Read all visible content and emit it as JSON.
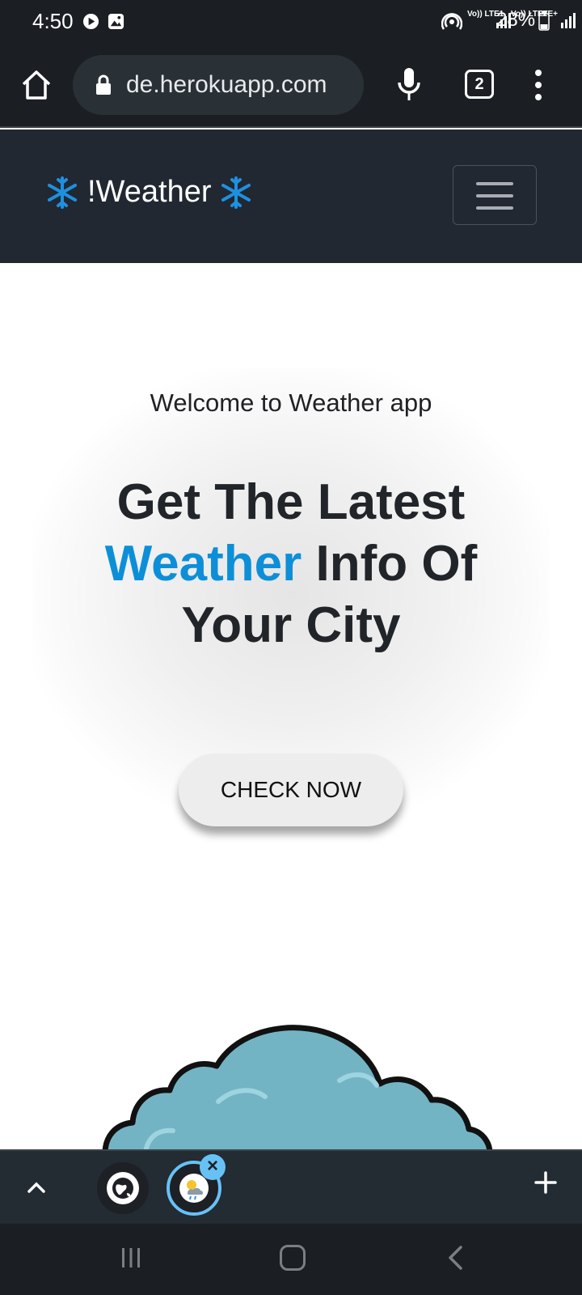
{
  "status_bar": {
    "time": "4:50",
    "battery": "28%",
    "icons": [
      "youtube-music-icon",
      "gallery-icon",
      "hotspot-icon",
      "volte-lte1-icon",
      "signal-icon",
      "volte-lte2-icon",
      "lte-plus-icon",
      "signal-icon",
      "battery-icon"
    ],
    "network_labels": [
      "Vo)) LTE1",
      "Vo)) LTE2",
      "LTE+"
    ]
  },
  "browser": {
    "url": "de.herokuapp.com",
    "tab_count": "2",
    "icons": [
      "home-icon",
      "lock-icon",
      "mic-icon",
      "tabs-icon",
      "more-vert-icon"
    ]
  },
  "navbar": {
    "brand": "!Weather",
    "brand_icon": "snowflake-icon",
    "toggler_icon": "hamburger-icon"
  },
  "hero": {
    "welcome": "Welcome to Weather app",
    "headline_part1": "Get The Latest",
    "headline_accent": "Weather",
    "headline_part2": "Info Of Your City",
    "cta": "CHECK NOW"
  },
  "tab_strip": {
    "icons": [
      "chevron-up-icon",
      "globe-icon",
      "weather-favicon-icon",
      "close-icon",
      "plus-icon"
    ],
    "close_label": "×"
  },
  "colors": {
    "accent": "#0d8fd8",
    "navbar_bg": "#212832",
    "status_bg": "#1b1f23",
    "tab_ring": "#67c1f5",
    "cloud_fill": "#73b4c4"
  }
}
